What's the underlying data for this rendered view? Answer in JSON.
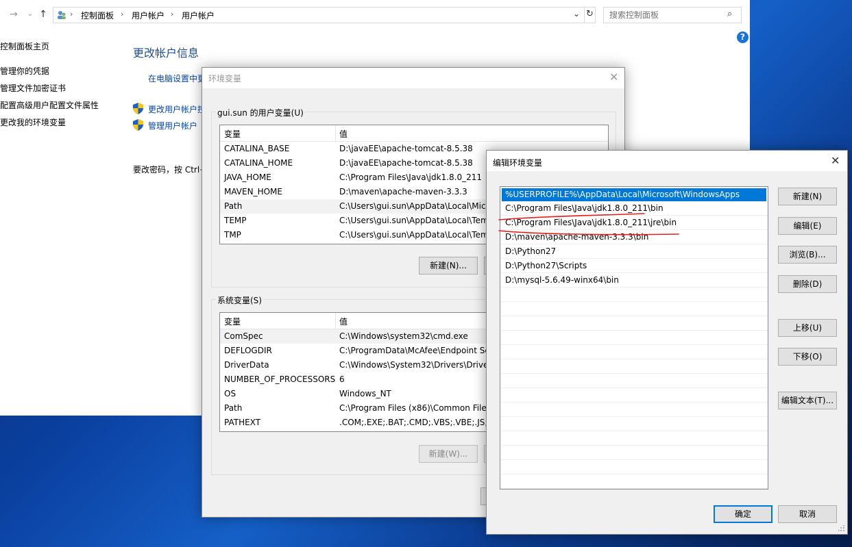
{
  "control_panel": {
    "breadcrumb": [
      "控制面板",
      "用户帐户",
      "用户帐户"
    ],
    "search_placeholder": "搜索控制面板",
    "help": "?",
    "sidebar": {
      "home": "控制面板主页",
      "items": [
        "管理你的凭据",
        "管理文件加密证书",
        "配置高级用户配置文件属性",
        "更改我的环境变量"
      ]
    },
    "heading": "更改帐户信息",
    "links": [
      "在电脑设置中更",
      "更改用户帐户控",
      "管理用户帐户"
    ],
    "password_text": "要改密码，按 Ctrl+"
  },
  "env_dialog": {
    "title": "环境变量",
    "user_group_label": "gui.sun 的用户变量(U)",
    "system_group_label": "系统变量(S)",
    "col_var": "变量",
    "col_val": "值",
    "user_vars": [
      {
        "name": "CATALINA_BASE",
        "value": "D:\\javaEE\\apache-tomcat-8.5.38"
      },
      {
        "name": "CATALINA_HOME",
        "value": "D:\\javaEE\\apache-tomcat-8.5.38"
      },
      {
        "name": "JAVA_HOME",
        "value": "C:\\Program Files\\Java\\jdk1.8.0_211"
      },
      {
        "name": "MAVEN_HOME",
        "value": "D:\\maven\\apache-maven-3.3.3"
      },
      {
        "name": "Path",
        "value": "C:\\Users\\gui.sun\\AppData\\Local\\Mic"
      },
      {
        "name": "TEMP",
        "value": "C:\\Users\\gui.sun\\AppData\\Local\\Tem"
      },
      {
        "name": "TMP",
        "value": "C:\\Users\\gui.sun\\AppData\\Local\\Tem"
      }
    ],
    "system_vars": [
      {
        "name": "ComSpec",
        "value": "C:\\Windows\\system32\\cmd.exe"
      },
      {
        "name": "DEFLOGDIR",
        "value": "C:\\ProgramData\\McAfee\\Endpoint Se"
      },
      {
        "name": "DriverData",
        "value": "C:\\Windows\\System32\\Drivers\\Driver"
      },
      {
        "name": "NUMBER_OF_PROCESSORS",
        "value": "6"
      },
      {
        "name": "OS",
        "value": "Windows_NT"
      },
      {
        "name": "Path",
        "value": "C:\\Program Files (x86)\\Common Files"
      },
      {
        "name": "PATHEXT",
        "value": ".COM;.EXE;.BAT;.CMD;.VBS;.VBE;.JS;.JS"
      }
    ],
    "user_new_button": "新建(N)...",
    "system_new_button": "新建(W)..."
  },
  "edit_dialog": {
    "title": "编辑环境变量",
    "entries": [
      "%USERPROFILE%\\AppData\\Local\\Microsoft\\WindowsApps",
      "C:\\Program Files\\Java\\jdk1.8.0_211\\bin",
      "C:\\Program Files\\Java\\jdk1.8.0_211\\jre\\bin",
      "D:\\maven\\apache-maven-3.3.3\\bin",
      "D:\\Python27",
      "D:\\Python27\\Scripts",
      "D:\\mysql-5.6.49-winx64\\bin"
    ],
    "buttons": {
      "new": "新建(N)",
      "edit": "编辑(E)",
      "browse": "浏览(B)...",
      "delete": "删除(D)",
      "move_up": "上移(U)",
      "move_down": "下移(O)",
      "edit_text": "编辑文本(T)...",
      "ok": "确定",
      "cancel": "取消"
    },
    "annotation_color": "#e0201e",
    "selection_color": "#0078d7"
  }
}
